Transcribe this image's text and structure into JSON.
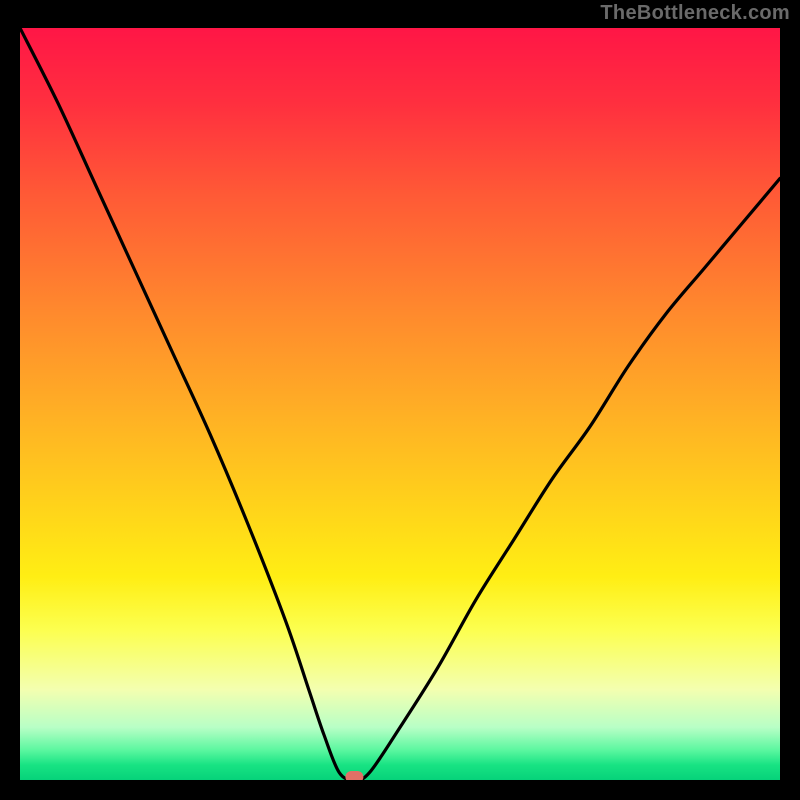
{
  "watermark": "TheBottleneck.com",
  "colors": {
    "frame_bg": "#000000",
    "gradient_top": "#ff1646",
    "gradient_mid": "#ffee14",
    "gradient_bottom": "#06d27a",
    "curve": "#000000",
    "marker": "#e07066"
  },
  "chart_data": {
    "type": "line",
    "title": "",
    "xlabel": "",
    "ylabel": "",
    "xlim": [
      0,
      100
    ],
    "ylim": [
      0,
      100
    ],
    "grid": false,
    "legend": false,
    "annotations": [
      {
        "text": "TheBottleneck.com",
        "position": "top-right"
      }
    ],
    "minimum_point": {
      "x": 44,
      "y": 0
    },
    "series": [
      {
        "name": "bottleneck-curve",
        "x": [
          0,
          5,
          10,
          15,
          20,
          25,
          30,
          35,
          38,
          40,
          42,
          44,
          46,
          50,
          55,
          60,
          65,
          70,
          75,
          80,
          85,
          90,
          95,
          100
        ],
        "y": [
          100,
          90,
          79,
          68,
          57,
          46,
          34,
          21,
          12,
          6,
          1,
          0,
          1,
          7,
          15,
          24,
          32,
          40,
          47,
          55,
          62,
          68,
          74,
          80
        ]
      }
    ],
    "markers": [
      {
        "x": 44,
        "y": 0,
        "color": "#e07066",
        "shape": "rounded-rect"
      }
    ]
  }
}
